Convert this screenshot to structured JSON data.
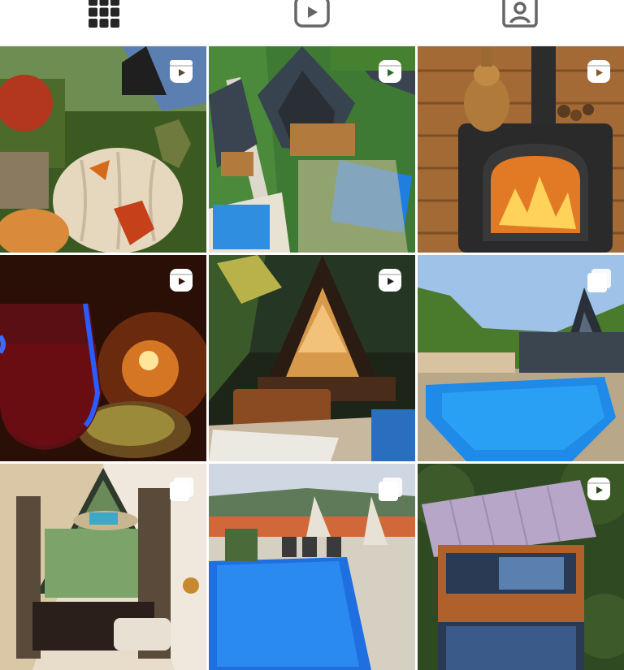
{
  "tabs": [
    {
      "icon": "grid-icon",
      "active": true
    },
    {
      "icon": "reels-icon",
      "active": false
    },
    {
      "icon": "tagged-icon",
      "active": false
    }
  ],
  "posts": [
    {
      "subject": "autumn-pumpkins",
      "type": "reel"
    },
    {
      "subject": "aframe-cabins-pool-aerial",
      "type": "reel"
    },
    {
      "subject": "wood-stove-teapot",
      "type": "reel"
    },
    {
      "subject": "wine-candlelight",
      "type": "reel"
    },
    {
      "subject": "aframe-cabin-night",
      "type": "reel"
    },
    {
      "subject": "aframe-cabin-pool",
      "type": "carousel"
    },
    {
      "subject": "cabin-interior-window",
      "type": "carousel"
    },
    {
      "subject": "pool-terrace-view",
      "type": "carousel"
    },
    {
      "subject": "cabin-aerial-forest",
      "type": "reel"
    }
  ],
  "colors": {
    "icon": "#262626",
    "badge": "#ffffff"
  }
}
